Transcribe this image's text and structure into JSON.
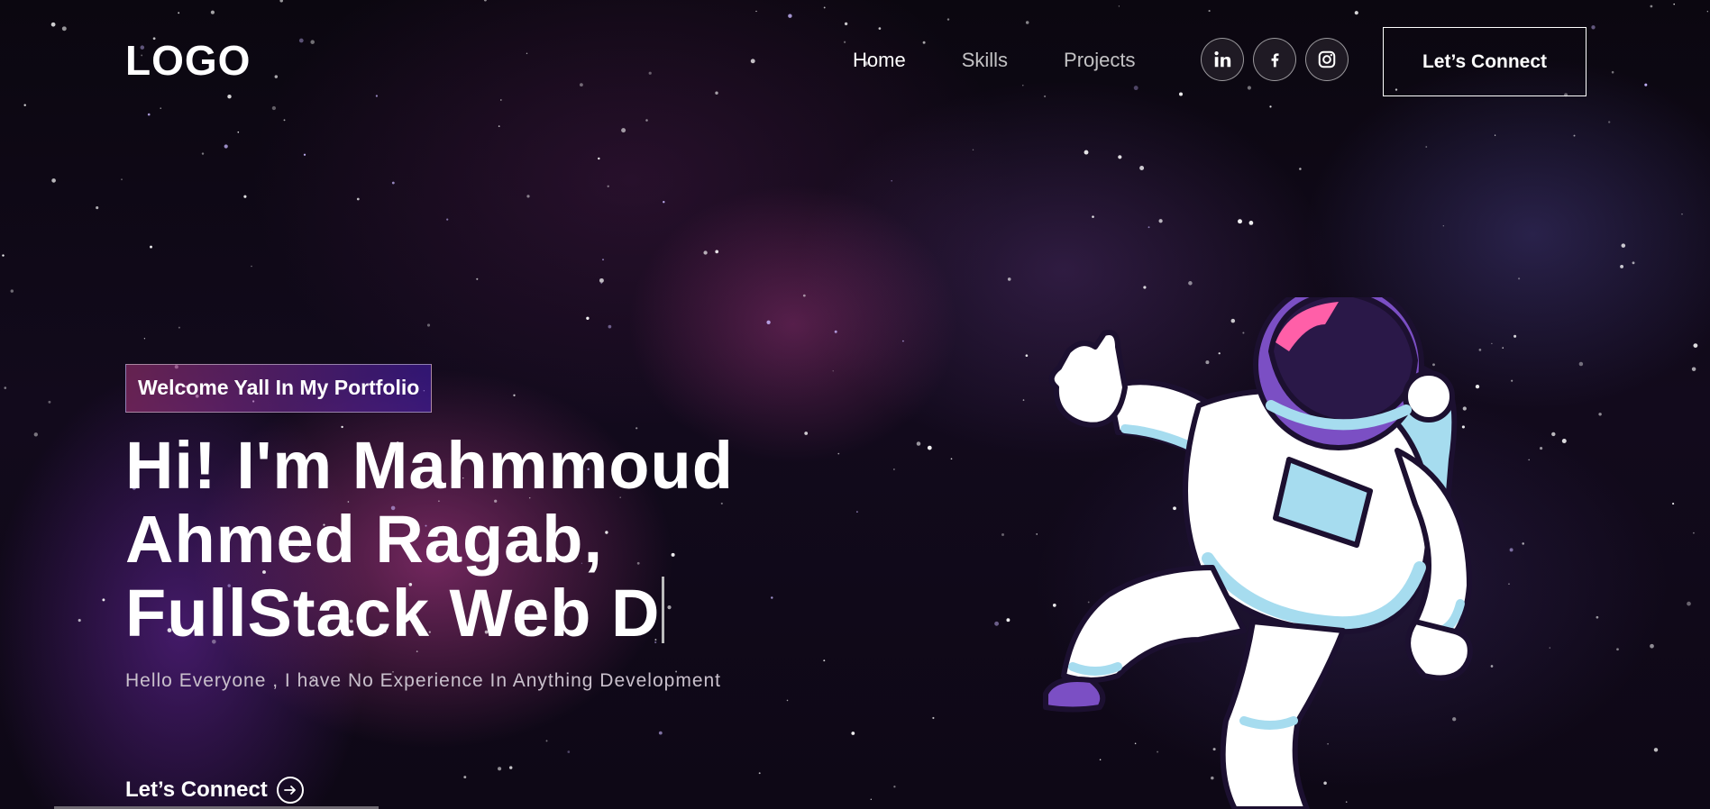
{
  "header": {
    "logo": "LOGO",
    "nav": [
      {
        "label": "Home",
        "active": true
      },
      {
        "label": "Skills",
        "active": false
      },
      {
        "label": "Projects",
        "active": false
      }
    ],
    "socials": [
      {
        "name": "linkedin-icon",
        "glyph": "in"
      },
      {
        "name": "facebook-icon",
        "glyph": "f"
      },
      {
        "name": "instagram-icon",
        "glyph": "ig"
      }
    ],
    "connect_label": "Let’s Connect"
  },
  "hero": {
    "tagline": "Welcome Yall In My Portfolio",
    "heading": "Hi! I'm Mahmmoud Ahmed Ragab, FullStack Web D",
    "subtitle": "Hello Everyone , I have No Experience In Anything Development",
    "cta_label": "Let’s Connect",
    "image": "astronaut illustration"
  },
  "colors": {
    "tagline_gradient_start": "#aa367c",
    "tagline_gradient_end": "#4a2fbd",
    "suit_white": "#ffffff",
    "suit_blue": "#a6dcef",
    "visor_dark": "#2a1848",
    "helmet_purple": "#7b4fc4",
    "visor_pink": "#ff5fa8",
    "outline": "#1c1030"
  }
}
